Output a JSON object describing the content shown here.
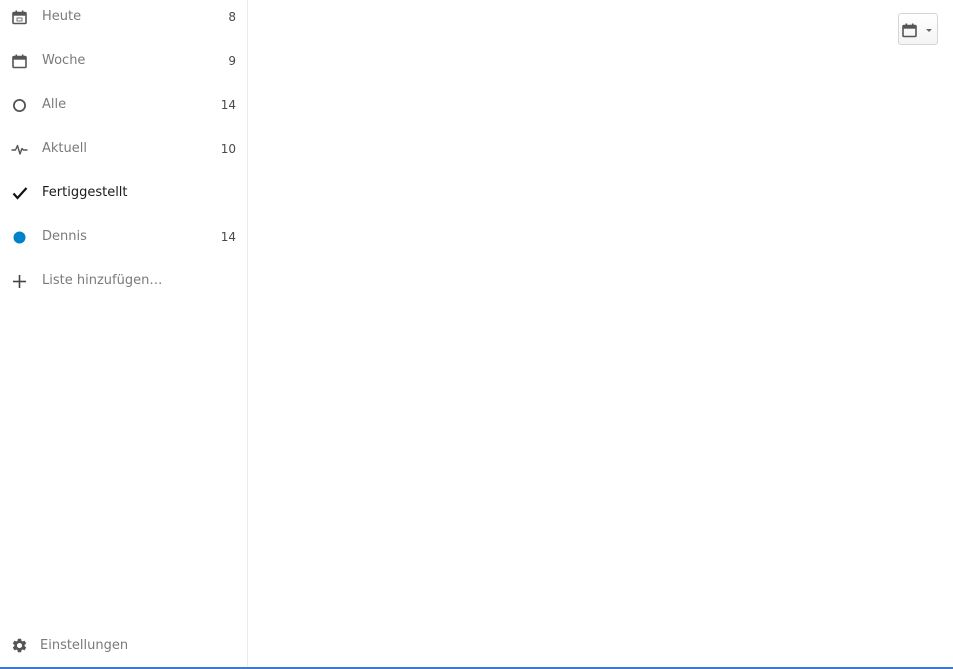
{
  "sidebar": {
    "items": [
      {
        "label": "Heute",
        "count": "8",
        "icon": "calendar-today-icon"
      },
      {
        "label": "Woche",
        "count": "9",
        "icon": "calendar-week-icon"
      },
      {
        "label": "Alle",
        "count": "14",
        "icon": "circle-outline-icon"
      },
      {
        "label": "Aktuell",
        "count": "10",
        "icon": "activity-icon"
      },
      {
        "label": "Fertiggestellt",
        "count": "",
        "icon": "checkmark-icon"
      },
      {
        "label": "Dennis",
        "count": "14",
        "icon": "color-dot-icon",
        "color": "#0082c9"
      },
      {
        "label": "Liste hinzufügen…",
        "count": "",
        "icon": "plus-icon"
      }
    ],
    "settings_label": "Einstellungen"
  },
  "main": {
    "calendar_dropdown_icon": "calendar-icon"
  },
  "colors": {
    "accent": "#0082c9",
    "bottom_bar": "#3b7dc4"
  }
}
